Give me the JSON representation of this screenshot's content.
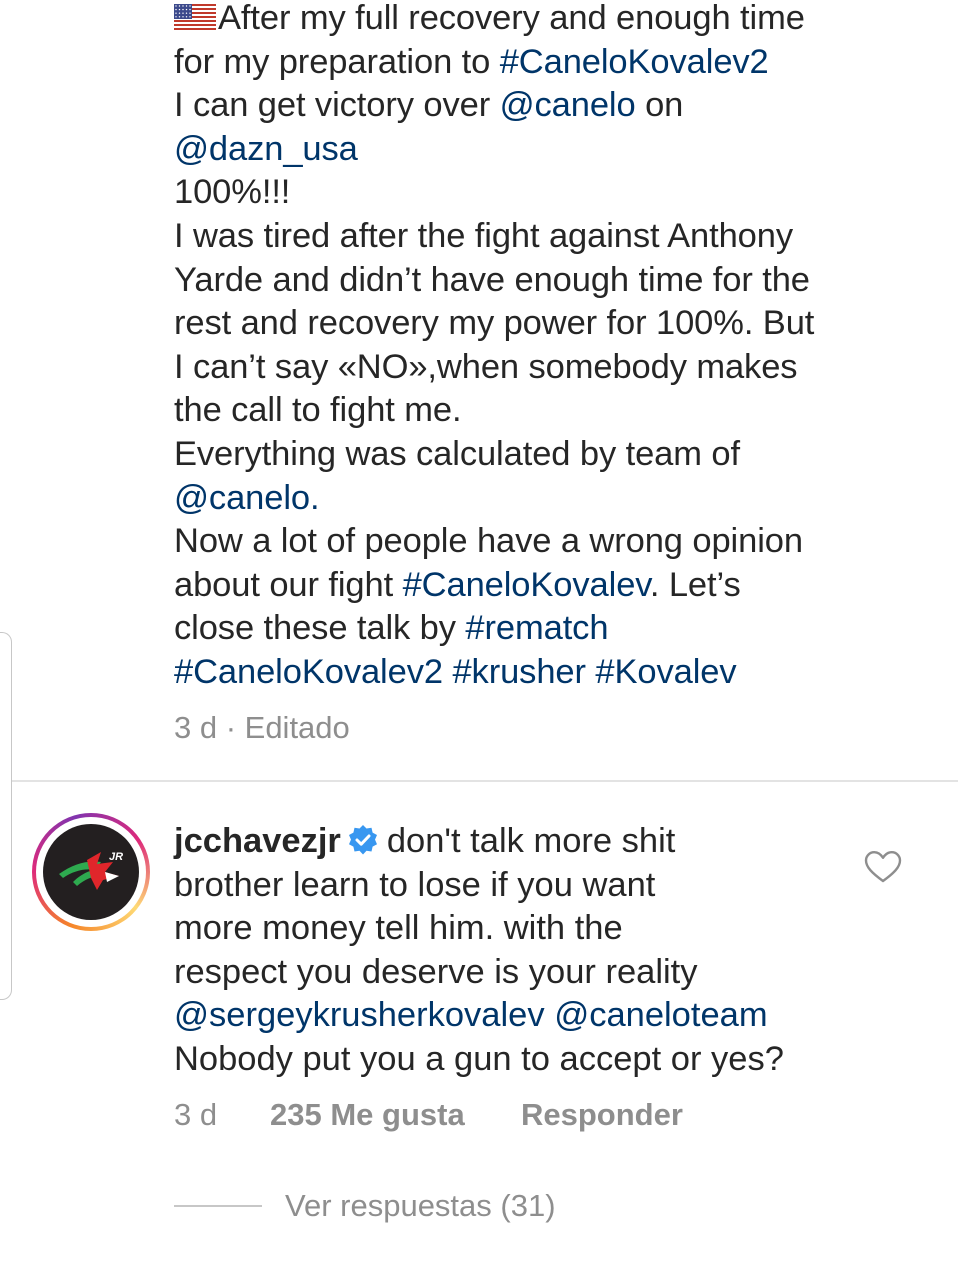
{
  "caption": {
    "flag": "us-flag-emoji",
    "lines": [
      [
        {
          "t": "After my full recovery and enough time",
          "link": false
        }
      ],
      [
        {
          "t": "for my preparation to ",
          "link": false
        },
        {
          "t": "#CaneloKovalev2",
          "link": true
        }
      ],
      [
        {
          "t": "I can get victory over ",
          "link": false
        },
        {
          "t": "@canelo",
          "link": true
        },
        {
          "t": " on",
          "link": false
        }
      ],
      [
        {
          "t": "@dazn_usa",
          "link": true
        }
      ],
      [
        {
          "t": "100%!!!",
          "link": false
        }
      ],
      [
        {
          "t": "I was tired after the fight against Anthony",
          "link": false
        }
      ],
      [
        {
          "t": "Yarde and didn’t have enough time for the",
          "link": false
        }
      ],
      [
        {
          "t": "rest and recovery my power for 100%. But",
          "link": false
        }
      ],
      [
        {
          "t": "I can’t say «NO»,when somebody makes",
          "link": false
        }
      ],
      [
        {
          "t": "the call to fight me.",
          "link": false
        }
      ],
      [
        {
          "t": "Everything was calculated by team of",
          "link": false
        }
      ],
      [
        {
          "t": "@canelo.",
          "link": true
        }
      ],
      [
        {
          "t": "Now a lot of people have a wrong opinion",
          "link": false
        }
      ],
      [
        {
          "t": "about our fight ",
          "link": false
        },
        {
          "t": "#CaneloKovalev",
          "link": true
        },
        {
          "t": ". Let’s",
          "link": false
        }
      ],
      [
        {
          "t": "close these talk by ",
          "link": false
        },
        {
          "t": "#rematch",
          "link": true
        }
      ],
      [
        {
          "t": "#CaneloKovalev2",
          "link": true
        },
        {
          "t": " ",
          "link": false
        },
        {
          "t": "#krusher",
          "link": true
        },
        {
          "t": " ",
          "link": false
        },
        {
          "t": "#Kovalev",
          "link": true
        }
      ]
    ],
    "meta": "3 d · Editado"
  },
  "comment": {
    "username": "jcchavezjr",
    "verified_icon": "verified-badge-icon",
    "first_line_text": "don't talk more shit",
    "lines": [
      [
        {
          "t": "brother learn to lose if you want",
          "link": false
        }
      ],
      [
        {
          "t": "more money tell him. with the",
          "link": false
        }
      ],
      [
        {
          "t": "respect you deserve is your reality",
          "link": false
        }
      ],
      [
        {
          "t": "@sergeykrusherkovalev",
          "link": true
        },
        {
          "t": " ",
          "link": false
        },
        {
          "t": "@caneloteam",
          "link": true
        }
      ],
      [
        {
          "t": "Nobody put you a gun to accept or yes?",
          "link": false
        }
      ]
    ],
    "avatar_logo_text": "JR",
    "time": "3 d",
    "likes": "235 Me gusta",
    "reply_label": "Responder",
    "like_icon": "heart-outline-icon"
  },
  "replies": {
    "label": "Ver respuestas (31)"
  },
  "colors": {
    "text": "#262626",
    "link": "#003569",
    "meta": "#8e8e8e",
    "divider": "#e3e3e3"
  }
}
